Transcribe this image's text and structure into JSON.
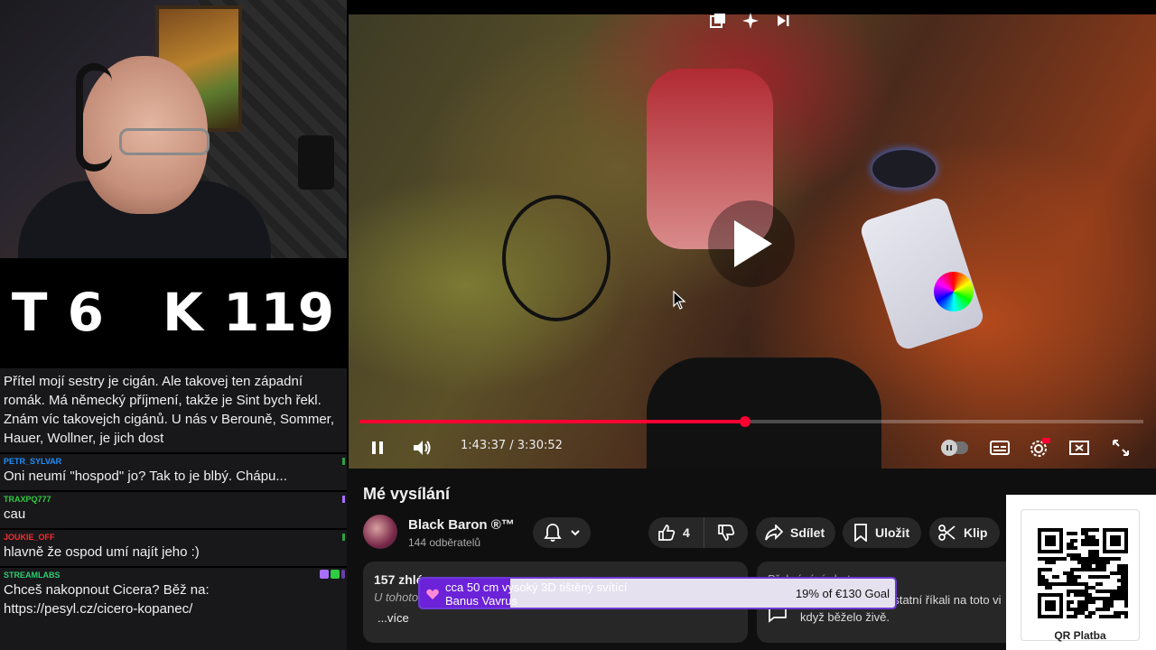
{
  "overlay": {
    "score": {
      "left": "T 6",
      "right": "K 119"
    },
    "chat": [
      {
        "user": "",
        "user_color": "",
        "text": "Přítel mojí sestry je cigán. Ale takovej ten západní romák. Má německý příjmení, takže je Sint bych řekl. Znám víc takovejch cigánů. U nás v Berouně, Sommer, Hauer, Wollner, je jich dost"
      },
      {
        "user": "PETR_SYLVAR",
        "user_color": "#1e90ff",
        "text": "Oni neumí \"hospod\" jo? Tak to je blbý. Chápu..."
      },
      {
        "user": "TRAXPQ777",
        "user_color": "#2ecc40",
        "text": "cau"
      },
      {
        "user": "JOUKIE_OFF",
        "user_color": "#ff2a2a",
        "text": "hlavně že ospod umí najít jeho :)"
      },
      {
        "user": "STREAMLABS",
        "user_color": "#2ecc71",
        "text": "Chceš nakopnout Cicera? Běž na: https://pesyl.cz/cicero-kopanec/"
      }
    ]
  },
  "player": {
    "time_current": "1:43:37",
    "time_separator": " / ",
    "time_total": "3:30:52",
    "progress_fraction": 0.492
  },
  "video_info": {
    "title": "Mé vysílání",
    "channel": "Black Baron ®™",
    "subscribers": "144 odběratelů",
    "likes": "4",
    "share_label": "Sdílet",
    "save_label": "Uložit",
    "clip_label": "Klip"
  },
  "description": {
    "views": "157 zhlé",
    "sub": "U tohoto",
    "more": "...více"
  },
  "chat_replay": {
    "header": "Přehrávání chatu",
    "text": "Podívejte se, co ostatní říkali na toto vi když běželo živě."
  },
  "goal": {
    "line1": "cca 50 cm vysoký 3D tištěný svítící",
    "line2": "Banus Vavrus",
    "amount": "19% of €130 Goal",
    "fraction": 0.19
  },
  "qr": {
    "label": "QR Platba"
  },
  "colors": {
    "accent": "#ff0033",
    "goal": "#6b22d8",
    "chat_bg": "#18181b"
  }
}
